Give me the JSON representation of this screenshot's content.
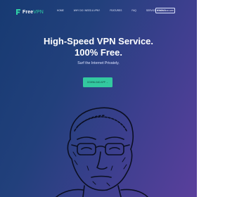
{
  "brand": {
    "name_strong": "Free",
    "name_light": "VPN"
  },
  "nav": {
    "links": [
      "Home",
      "Why do I need a VPN?",
      "Features",
      "FAQ",
      "Service Status"
    ],
    "cta_label": "Download App"
  },
  "hero": {
    "title_line1": "High-Speed VPN Service.",
    "title_line2": "100% Free.",
    "subtitle": "Surf the Internet Privately.",
    "button_label": "Download App →"
  },
  "colors": {
    "accent": "#33c9a0",
    "background_start": "#173a72",
    "background_end": "#5a3f9c"
  }
}
